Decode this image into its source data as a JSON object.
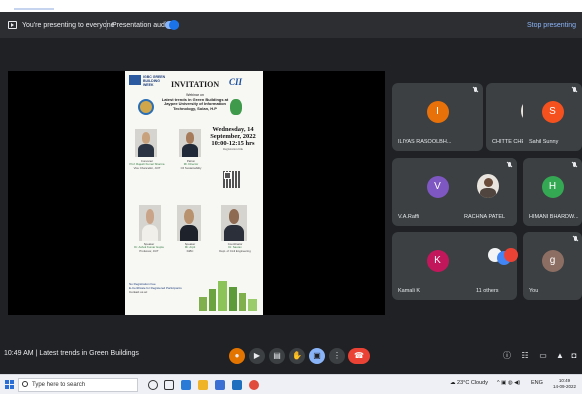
{
  "presenting_bar": {
    "status": "You're presenting to everyone",
    "audio_label": "Presentation audio",
    "stop_label": "Stop presenting"
  },
  "slide": {
    "org": "IGBC GREEN BUILDING WEEK",
    "title": "INVITATION",
    "partner": "CII",
    "intro_1": "Webinar on",
    "intro_2": "Latest trends in Green Buildings at",
    "intro_3": "Jaypee University of Information Technology, Solan, H.P",
    "date_1": "Wednesday, 14",
    "date_2": "September, 2022",
    "date_3": "10:00-12:15 hrs",
    "date_note": "Registration link",
    "speakers": [
      {
        "role": "Convener",
        "name": "Prof. Rajesh Kumar Sharma",
        "org": "Vice Chancellor, JUIT"
      },
      {
        "role": "Patron",
        "name": "Mr. Director",
        "org": "CII Sustainability"
      },
      {
        "role": "Speaker",
        "name": "Dr. Ashok Kumar Gupta",
        "org": "Professor, JUIT"
      },
      {
        "role": "Speaker",
        "name": "Mr. Arpit",
        "org": "IGBC"
      },
      {
        "role": "Coordinator",
        "name": "Dr. Saurav",
        "org": "Dept. of Civil Engineering"
      }
    ],
    "footnote_1": "No Registration Fee",
    "footnote_2": "E-Certificate for Registered Participants",
    "footnote_3": "Contact us at:"
  },
  "participants": [
    {
      "name": "ILIYAS RASOOLBH...",
      "initial": "I",
      "color": "#e8710a",
      "type": "initial"
    },
    {
      "name": "CHITTE CHETAN (...",
      "initial": "",
      "color": "",
      "type": "photo"
    },
    {
      "name": "Sahil Sunny",
      "initial": "S",
      "color": "#f4511e",
      "type": "initial"
    },
    {
      "name": "V.A.Raffi",
      "initial": "V",
      "color": "#7e57c2",
      "type": "initial"
    },
    {
      "name": "RACHNA PATEL",
      "initial": "",
      "color": "",
      "type": "photo"
    },
    {
      "name": "HIMANI BHARDW...",
      "initial": "H",
      "color": "#34a853",
      "type": "initial"
    },
    {
      "name": "Kamali K",
      "initial": "K",
      "color": "#c2185b",
      "type": "initial"
    },
    {
      "name": "11 others",
      "initial": "",
      "color": "",
      "type": "others"
    },
    {
      "name": "You",
      "initial": "g",
      "color": "#8d6e63",
      "type": "initial"
    }
  ],
  "meeting": {
    "time": "10:49 AM",
    "separator": "|",
    "title": "Latest trends in Green Buildings"
  },
  "controls": [
    "mic-icon",
    "camera-icon",
    "captions-icon",
    "raise-hand-icon",
    "present-icon",
    "more-icon",
    "end-call-icon"
  ],
  "side_controls": [
    "info-icon",
    "people-icon",
    "chat-icon",
    "activities-icon",
    "lock-icon"
  ],
  "taskbar": {
    "search_placeholder": "Type here to search",
    "weather": "23°C Cloudy",
    "lang": "ENG",
    "time": "10:49",
    "date": "14-09-2022"
  }
}
